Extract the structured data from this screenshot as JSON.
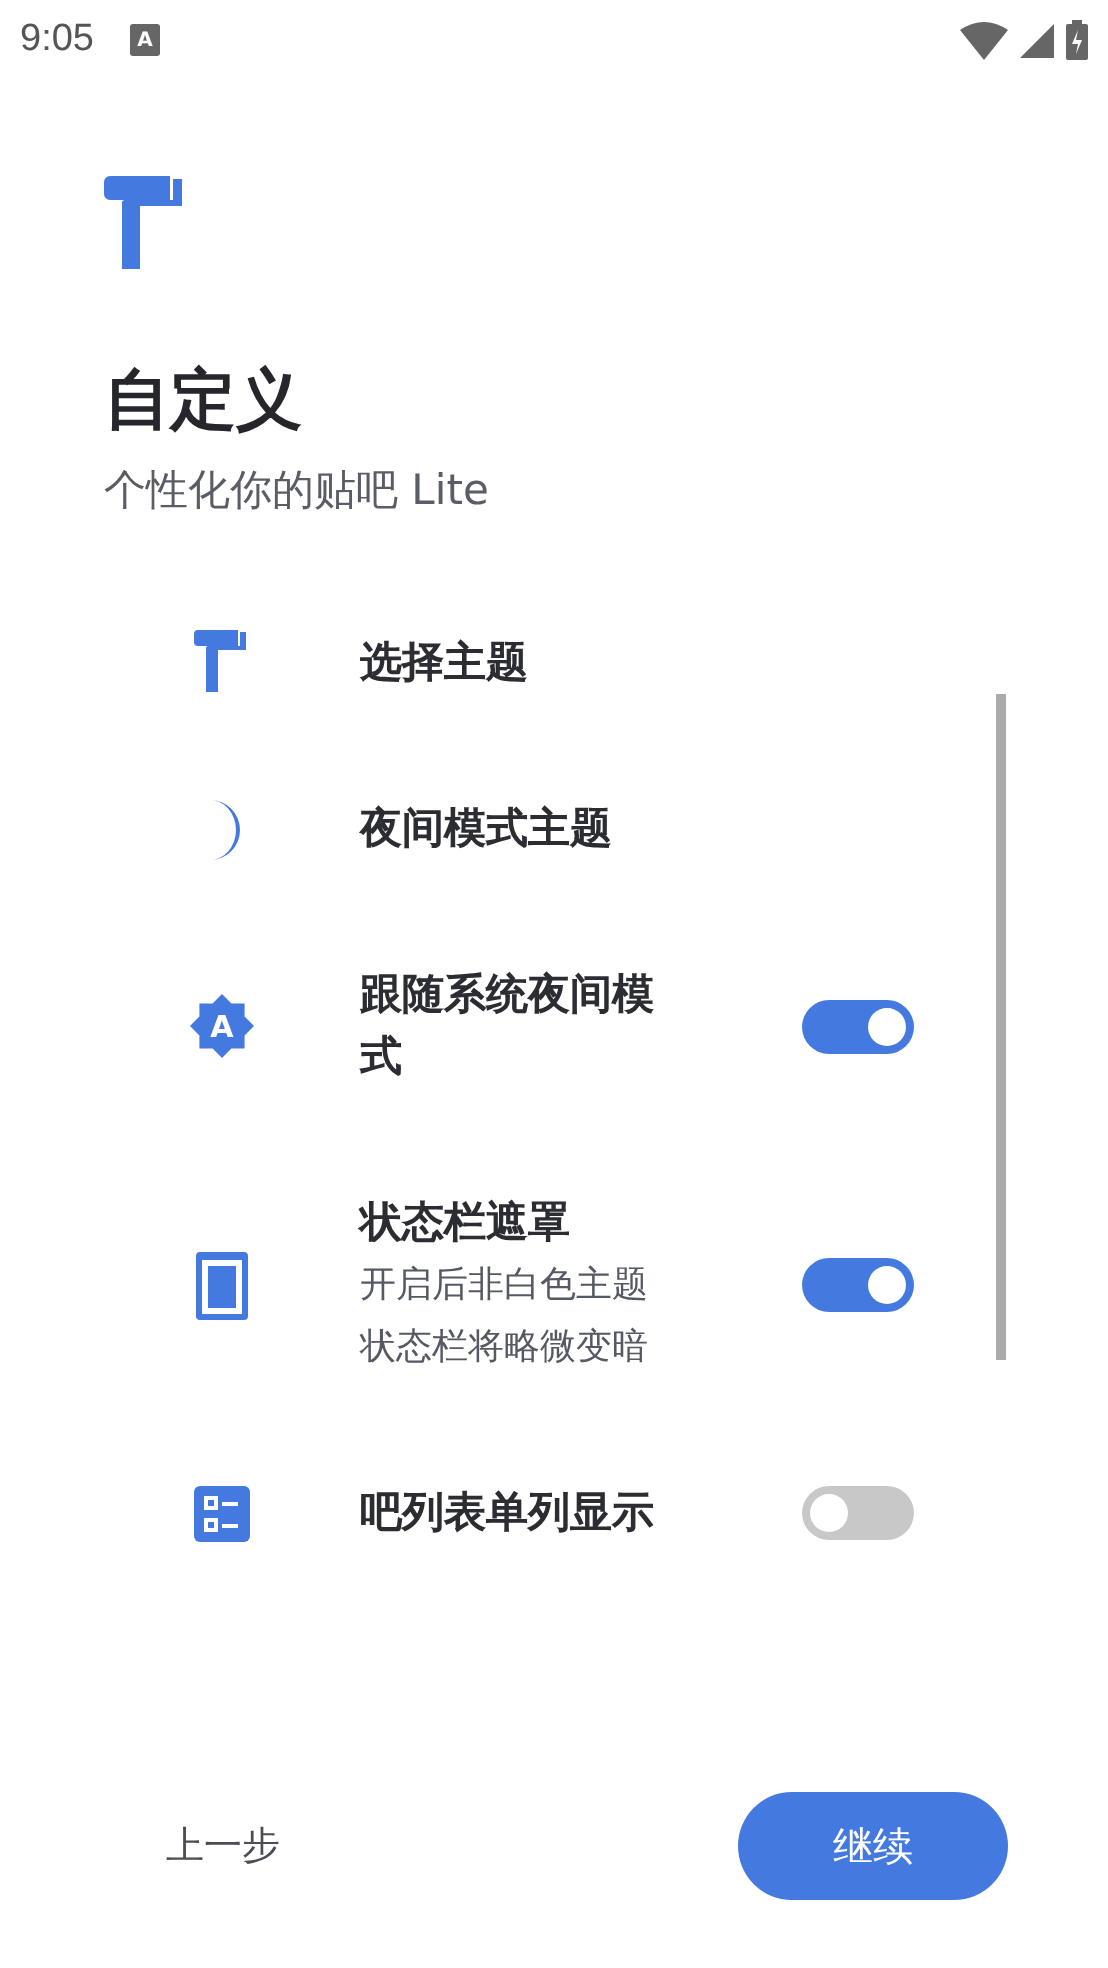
{
  "status_bar": {
    "time": "9:05",
    "notification_letter": "A"
  },
  "header": {
    "title": "自定义",
    "subtitle": "个性化你的贴吧 Lite"
  },
  "settings": [
    {
      "kind": "link",
      "title": "选择主题"
    },
    {
      "kind": "link",
      "title": "夜间模式主题"
    },
    {
      "kind": "switch",
      "icon_letter": "A",
      "title": "跟随系统夜间模式",
      "on": true
    },
    {
      "kind": "switch",
      "title": "状态栏遮罩",
      "description": "开启后非白色主题状态栏将略微变暗",
      "on": true
    },
    {
      "kind": "switch",
      "title": "吧列表单列显示",
      "on": false
    }
  ],
  "footer": {
    "back": "上一步",
    "next": "继续"
  }
}
